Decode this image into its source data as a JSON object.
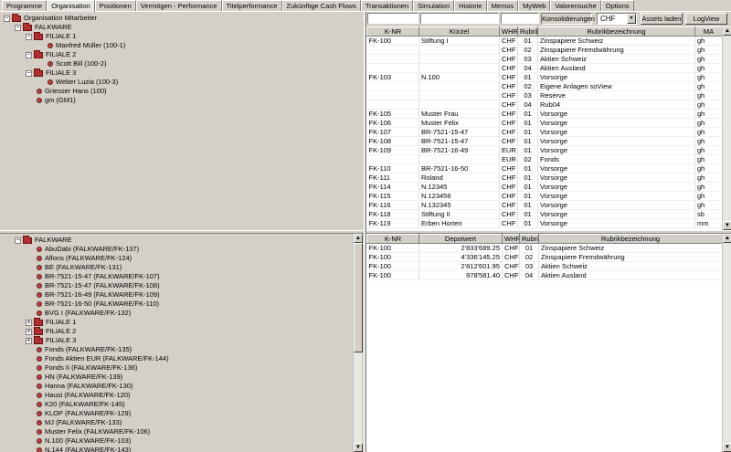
{
  "tabs": [
    "Programme",
    "Organisation",
    "Positionen",
    "Vermögen - Performance",
    "Titelperformance",
    "Zukünftige Cash Flows",
    "Transaktionen",
    "Simulation",
    "Historie",
    "Memos",
    "MyWeb",
    "Valorensuche",
    "Options"
  ],
  "active_tab": "Organisation",
  "top_tree": {
    "root": "Organisation Mitarbeiter",
    "falkware": "FALKWARE",
    "filiale1": "FILIALE 1",
    "mueller": "Manfred Müller (100-1)",
    "filiale2": "FILIALE 2",
    "bill": "Scott Bill (100-2)",
    "filiale3": "FILIALE 3",
    "weber": "Weber Luzia (100-3)",
    "griesser": "Griesser Hans (100)",
    "gm": "gm (GM1)"
  },
  "bottom_tree": {
    "root": "FALKWARE",
    "items": [
      "AbuDabi (FALKWARE/FK-137)",
      "Alfons (FALKWARE/FK-124)",
      "BE (FALKWARE/FK-131)",
      "BR-7521-15-47 (FALKWARE/FK-107)",
      "BR-7521-15-47 (FALKWARE/FK-108)",
      "BR-7521-16-49 (FALKWARE/FK-109)",
      "BR-7521-16-50 (FALKWARE/FK-110)",
      "BVG I (FALKWARE/FK-132)"
    ],
    "filialen": [
      "FILIALE 1",
      "FILIALE 2",
      "FILIALE 3"
    ],
    "items2": [
      "Fonds (FALKWARE/FK-135)",
      "Fonds Aktien EUR (FALKWARE/FK-144)",
      "Fonds II (FALKWARE/FK-136)",
      "HN (FALKWARE/FK-139)",
      "Hanna (FALKWARE/FK-130)",
      "Hausi (FALKWARE/FK-120)",
      "K20 (FALKWARE/FK-145)",
      "KLOP (FALKWARE/FK-129)",
      "MJ (FALKWARE/FK-133)",
      "Muster Felix (FALKWARE/FK-106)",
      "N.100 (FALKWARE/FK-103)",
      "N.144 (FALKWARE/FK-143)"
    ]
  },
  "toolbar": {
    "konsolidierungen": "Konsolidierungen",
    "currency": "CHF",
    "assets_laden": "Assets laden",
    "logview": "LogView"
  },
  "top_grid": {
    "headers": [
      "K-NR",
      "Kürzel",
      "WHR",
      "Rubrik",
      "Rubrikbezeichnung",
      "MA"
    ],
    "rows": [
      [
        "FK-100",
        "Stiftung I",
        "CHF",
        "01",
        "Zinspapiere Schweiz",
        "gh"
      ],
      [
        "",
        "",
        "CHF",
        "02",
        "Zinspapiere Fremdwährung",
        "gh"
      ],
      [
        "",
        "",
        "CHF",
        "03",
        "Aktien Schweiz",
        "gh"
      ],
      [
        "",
        "",
        "CHF",
        "04",
        "Aktien Ausland",
        "gh"
      ],
      [
        "FK-103",
        "N.100",
        "CHF",
        "01",
        "Vorsorge",
        "gh"
      ],
      [
        "",
        "",
        "CHF",
        "02",
        "Eigene Anlagen soView",
        "gh"
      ],
      [
        "",
        "",
        "CHF",
        "03",
        "Reserve",
        "gh"
      ],
      [
        "",
        "",
        "CHF",
        "04",
        "Rub04",
        "gh"
      ],
      [
        "FK-105",
        "Muster Frau",
        "CHF",
        "01",
        "Vorsorge",
        "gh"
      ],
      [
        "FK-106",
        "Muster Felix",
        "CHF",
        "01",
        "Vorsorge",
        "gh"
      ],
      [
        "FK-107",
        "BR-7521-15-47",
        "CHF",
        "01",
        "Vorsorge",
        "gh"
      ],
      [
        "FK-108",
        "BR-7521-15-47",
        "CHF",
        "01",
        "Vorsorge",
        "gh"
      ],
      [
        "FK-109",
        "BR-7521-16-49",
        "EUR",
        "01",
        "Vorsorge",
        "gh"
      ],
      [
        "",
        "",
        "EUR",
        "02",
        "Fonds",
        "gh"
      ],
      [
        "FK-110",
        "BR-7521-16-50",
        "CHF",
        "01",
        "Vorsorge",
        "gh"
      ],
      [
        "FK-111",
        "Roland",
        "CHF",
        "01",
        "Vorsorge",
        "gh"
      ],
      [
        "FK-114",
        "N.12345",
        "CHF",
        "01",
        "Vorsorge",
        "gh"
      ],
      [
        "FK-115",
        "N.123456",
        "CHF",
        "01",
        "Vorsorge",
        "gh"
      ],
      [
        "FK-116",
        "N.132345",
        "CHF",
        "01",
        "Vorsorge",
        "gh"
      ],
      [
        "FK-118",
        "Stiftung II",
        "CHF",
        "01",
        "Vorsorge",
        "sb"
      ],
      [
        "FK-119",
        "Erben Horten",
        "CHF",
        "01",
        "Vorsorge",
        "mm"
      ]
    ]
  },
  "bottom_grid": {
    "headers": [
      "K-NR",
      "Depotwert",
      "WHR",
      "Rubrik",
      "Rubrikbezeichnung"
    ],
    "rows": [
      [
        "FK-100",
        "2'833'689.25",
        "CHF",
        "01",
        "Zinspapiere Schweiz"
      ],
      [
        "FK-100",
        "4'336'145.25",
        "CHF",
        "02",
        "Zinspapiere Fremdwährung"
      ],
      [
        "FK-100",
        "2'812'601.95",
        "CHF",
        "03",
        "Aktien Schweiz"
      ],
      [
        "FK-100",
        "978'581.40",
        "CHF",
        "04",
        "Aktien Ausland"
      ]
    ]
  }
}
